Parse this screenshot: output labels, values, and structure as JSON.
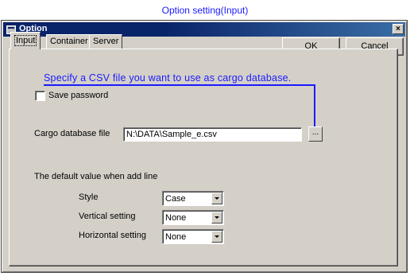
{
  "caption": "Option setting(Input)",
  "window": {
    "title": "Option",
    "close_glyph": "×"
  },
  "buttons": {
    "ok": "OK",
    "cancel": "Cancel"
  },
  "tabs": [
    {
      "label": "Input",
      "active": true
    },
    {
      "label": "Container",
      "active": false
    },
    {
      "label": "Server",
      "active": false
    }
  ],
  "annotation": "Specify a CSV file you want to use as cargo database.",
  "save_password": {
    "label": "Save password",
    "checked": false
  },
  "cargo_db": {
    "label": "Cargo database file",
    "value": "N:\\DATA\\Sample_e.csv",
    "browse_label": "..."
  },
  "defaults": {
    "heading": "The default value when add line",
    "style": {
      "label": "Style",
      "value": "Case"
    },
    "vertical": {
      "label": "Vertical setting",
      "value": "None"
    },
    "horizontal": {
      "label": "Horizontal setting",
      "value": "None"
    }
  },
  "colors": {
    "title_bar": "#0a246a",
    "annotation": "#1a1aff",
    "dialog_face": "#d4d0c8"
  }
}
